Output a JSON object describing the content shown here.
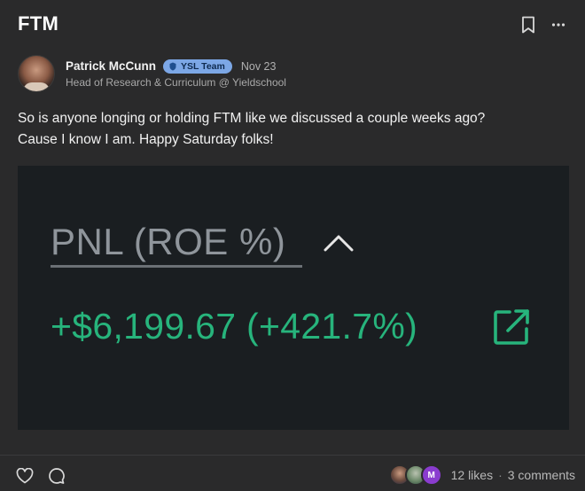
{
  "post": {
    "title": "FTM",
    "author": {
      "name": "Patrick McCunn",
      "badge": "YSL Team",
      "date": "Nov 23",
      "role": "Head of Research & Curriculum @ Yieldschool"
    },
    "body_line1": "So is anyone longing or holding FTM like we discussed a couple weeks ago?",
    "body_line2": "Cause I know I am. Happy Saturday folks!"
  },
  "image": {
    "pnl_label": "PNL (ROE %)",
    "pnl_value": "+$6,199.67 (+421.7%)",
    "value_color": "#27b47c"
  },
  "footer": {
    "likers": [
      {
        "initial": "",
        "icon": "avatar-photo"
      },
      {
        "initial": "",
        "icon": "avatar-photo"
      },
      {
        "initial": "M",
        "icon": "avatar-initial"
      }
    ],
    "likes": "12 likes",
    "separator": "·",
    "comments": "3 comments"
  },
  "icons": {
    "bookmark": "bookmark-icon",
    "more": "more-icon",
    "heart": "heart-icon",
    "comment": "comment-icon"
  }
}
